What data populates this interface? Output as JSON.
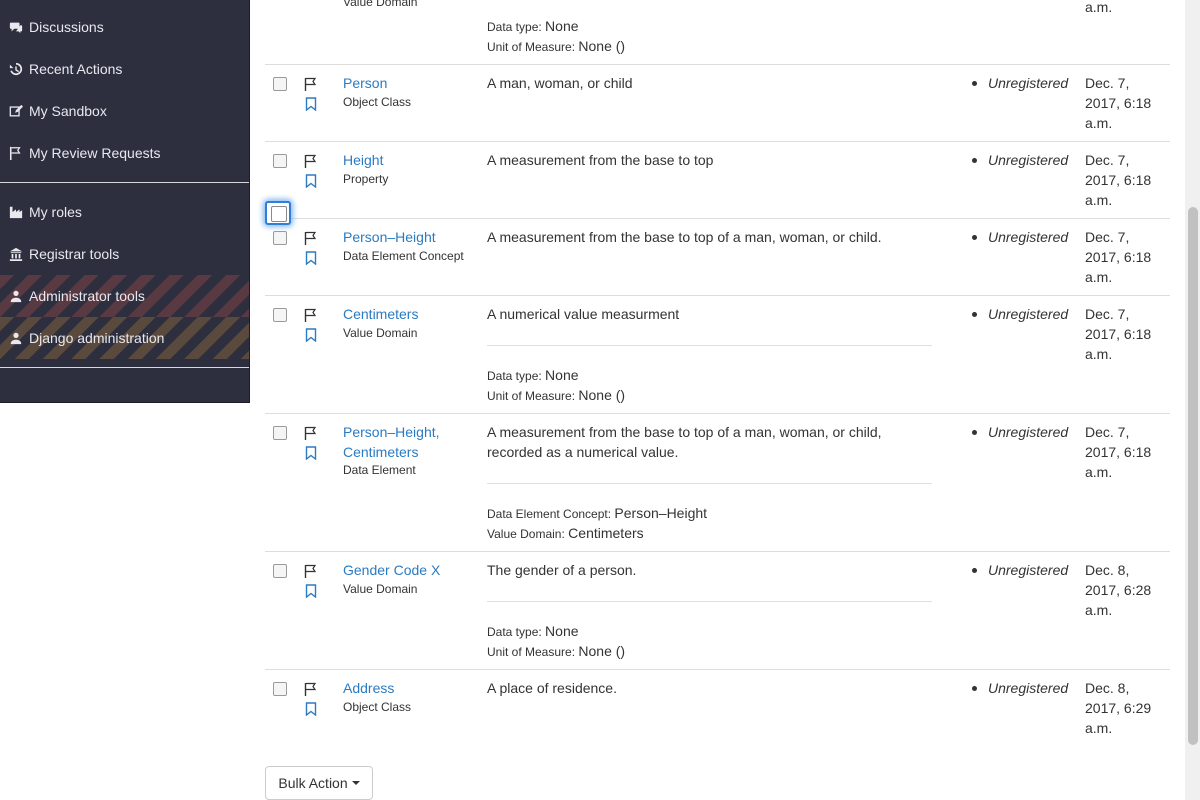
{
  "sidebar": {
    "items": [
      {
        "label": "Discussions",
        "icon": "comments-icon"
      },
      {
        "label": "Recent Actions",
        "icon": "history-icon"
      },
      {
        "label": "My Sandbox",
        "icon": "edit-icon"
      },
      {
        "label": "My Review Requests",
        "icon": "flag-icon"
      },
      {
        "label": "My roles",
        "icon": "industry-icon"
      },
      {
        "label": "Registrar tools",
        "icon": "institution-icon"
      },
      {
        "label": "Administrator tools",
        "icon": "user-secret-icon"
      },
      {
        "label": "Django administration",
        "icon": "user-secret-icon"
      }
    ]
  },
  "top_partial": {
    "type": "Value Domain",
    "date_tail": "a.m.",
    "data_type_label": "Data type:",
    "data_type_value": "None",
    "uom_label": "Unit of Measure:",
    "uom_value": "None ()"
  },
  "rows": [
    {
      "name": "Person",
      "type": "Object Class",
      "definition": "A man, woman, or child",
      "status": "Unregistered",
      "date": "Dec. 7, 2017, 6:18 a.m."
    },
    {
      "name": "Height",
      "type": "Property",
      "definition": "A measurement from the base to top",
      "status": "Unregistered",
      "date": "Dec. 7, 2017, 6:18 a.m."
    },
    {
      "name": "Person–Height",
      "type": "Data Element Concept",
      "definition": "A measurement from the base to top of a man, woman, or child.",
      "status": "Unregistered",
      "date": "Dec. 7, 2017, 6:18 a.m."
    },
    {
      "name": "Centimeters",
      "type": "Value Domain",
      "definition": "A numerical value measurment",
      "status": "Unregistered",
      "date": "Dec. 7, 2017, 6:18 a.m.",
      "details": [
        {
          "label": "Data type:",
          "value": "None"
        },
        {
          "label": "Unit of Measure:",
          "value": "None ()"
        }
      ]
    },
    {
      "name": "Person–Height, Centimeters",
      "type": "Data Element",
      "definition": "A measurement from the base to top of a man, woman, or child, recorded as a numerical value.",
      "status": "Unregistered",
      "date": "Dec. 7, 2017, 6:18 a.m.",
      "details": [
        {
          "label": "Data Element Concept:",
          "value": "Person–Height"
        },
        {
          "label": "Value Domain:",
          "value": "Centimeters"
        }
      ]
    },
    {
      "name": "Gender Code X",
      "type": "Value Domain",
      "definition": "The gender of a person.",
      "status": "Unregistered",
      "date": "Dec. 8, 2017, 6:28 a.m.",
      "details": [
        {
          "label": "Data type:",
          "value": "None"
        },
        {
          "label": "Unit of Measure:",
          "value": "None ()"
        }
      ]
    },
    {
      "name": "Address",
      "type": "Object Class",
      "definition": "A place of residence.",
      "status": "Unregistered",
      "date": "Dec. 8, 2017, 6:29 a.m."
    }
  ],
  "bulk_action": {
    "label": "Bulk Action"
  }
}
